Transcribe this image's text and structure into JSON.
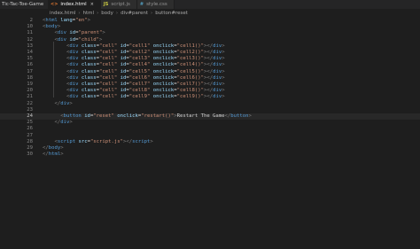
{
  "project": "Tic-Tac-Toe-Game",
  "tabs": [
    {
      "icon": "<>",
      "label": "index.html",
      "active": true,
      "close": "×"
    },
    {
      "icon": "JS",
      "label": "script.js",
      "active": false,
      "close": ""
    },
    {
      "icon": "#",
      "label": "style.css",
      "active": false,
      "close": ""
    }
  ],
  "breadcrumb": [
    "index.html",
    "html",
    "body",
    "div#parent",
    "button#reset"
  ],
  "lines": [
    {
      "num": "2",
      "tokens": [
        [
          "br",
          "<"
        ],
        [
          "tag",
          "html"
        ],
        [
          "txt",
          " "
        ],
        [
          "attr",
          "lang"
        ],
        [
          "txt",
          "="
        ],
        [
          "val",
          "\"en\""
        ],
        [
          "br",
          ">"
        ]
      ]
    },
    {
      "num": "10",
      "tokens": [
        [
          "br",
          "<"
        ],
        [
          "tag",
          "body"
        ],
        [
          "br",
          ">"
        ]
      ]
    },
    {
      "num": "11",
      "tokens": [
        [
          "txt",
          "    "
        ],
        [
          "br",
          "<"
        ],
        [
          "tag",
          "div"
        ],
        [
          "txt",
          " "
        ],
        [
          "attr",
          "id"
        ],
        [
          "txt",
          "="
        ],
        [
          "val",
          "\"parent\""
        ],
        [
          "br",
          ">"
        ]
      ]
    },
    {
      "num": "12",
      "tokens": [
        [
          "txt",
          "    "
        ],
        [
          "br",
          "<"
        ],
        [
          "tag",
          "div"
        ],
        [
          "txt",
          " "
        ],
        [
          "attr",
          "id"
        ],
        [
          "txt",
          "="
        ],
        [
          "val",
          "\"child\""
        ],
        [
          "br",
          ">"
        ]
      ]
    },
    {
      "num": "13",
      "tokens": [
        [
          "txt",
          "        "
        ],
        [
          "br",
          "<"
        ],
        [
          "tag",
          "div"
        ],
        [
          "txt",
          " "
        ],
        [
          "attr",
          "class"
        ],
        [
          "txt",
          "="
        ],
        [
          "val",
          "\"cell\""
        ],
        [
          "txt",
          " "
        ],
        [
          "attr",
          "id"
        ],
        [
          "txt",
          "="
        ],
        [
          "val",
          "\"cell1\""
        ],
        [
          "txt",
          " "
        ],
        [
          "attr",
          "onclick"
        ],
        [
          "txt",
          "="
        ],
        [
          "val",
          "\"cell1()\""
        ],
        [
          "br",
          "></"
        ],
        [
          "tag",
          "div"
        ],
        [
          "br",
          ">"
        ]
      ]
    },
    {
      "num": "14",
      "tokens": [
        [
          "txt",
          "        "
        ],
        [
          "br",
          "<"
        ],
        [
          "tag",
          "div"
        ],
        [
          "txt",
          " "
        ],
        [
          "attr",
          "class"
        ],
        [
          "txt",
          "="
        ],
        [
          "val",
          "\"cell\""
        ],
        [
          "txt",
          " "
        ],
        [
          "attr",
          "id"
        ],
        [
          "txt",
          "="
        ],
        [
          "val",
          "\"cell2\""
        ],
        [
          "txt",
          " "
        ],
        [
          "attr",
          "onclick"
        ],
        [
          "txt",
          "="
        ],
        [
          "val",
          "\"cell2()\""
        ],
        [
          "br",
          "></"
        ],
        [
          "tag",
          "div"
        ],
        [
          "br",
          ">"
        ]
      ]
    },
    {
      "num": "15",
      "tokens": [
        [
          "txt",
          "        "
        ],
        [
          "br",
          "<"
        ],
        [
          "tag",
          "div"
        ],
        [
          "txt",
          " "
        ],
        [
          "attr",
          "class"
        ],
        [
          "txt",
          "="
        ],
        [
          "val",
          "\"cell\""
        ],
        [
          "txt",
          " "
        ],
        [
          "attr",
          "id"
        ],
        [
          "txt",
          "="
        ],
        [
          "val",
          "\"cell3\""
        ],
        [
          "txt",
          " "
        ],
        [
          "attr",
          "onclick"
        ],
        [
          "txt",
          "="
        ],
        [
          "val",
          "\"cell3()\""
        ],
        [
          "br",
          "></"
        ],
        [
          "tag",
          "div"
        ],
        [
          "br",
          ">"
        ]
      ]
    },
    {
      "num": "16",
      "tokens": [
        [
          "txt",
          "        "
        ],
        [
          "br",
          "<"
        ],
        [
          "tag",
          "div"
        ],
        [
          "txt",
          " "
        ],
        [
          "attr",
          "class"
        ],
        [
          "txt",
          "="
        ],
        [
          "val",
          "\"cell\""
        ],
        [
          "txt",
          " "
        ],
        [
          "attr",
          "id"
        ],
        [
          "txt",
          "="
        ],
        [
          "val",
          "\"cell4\""
        ],
        [
          "txt",
          " "
        ],
        [
          "attr",
          "onclick"
        ],
        [
          "txt",
          "="
        ],
        [
          "val",
          "\"cell4()\""
        ],
        [
          "br",
          "></"
        ],
        [
          "tag",
          "div"
        ],
        [
          "br",
          ">"
        ]
      ]
    },
    {
      "num": "17",
      "tokens": [
        [
          "txt",
          "        "
        ],
        [
          "br",
          "<"
        ],
        [
          "tag",
          "div"
        ],
        [
          "txt",
          " "
        ],
        [
          "attr",
          "class"
        ],
        [
          "txt",
          "="
        ],
        [
          "val",
          "\"cell\""
        ],
        [
          "txt",
          " "
        ],
        [
          "attr",
          "id"
        ],
        [
          "txt",
          "="
        ],
        [
          "val",
          "\"cell5\""
        ],
        [
          "txt",
          " "
        ],
        [
          "attr",
          "onclick"
        ],
        [
          "txt",
          "="
        ],
        [
          "val",
          "\"cell5()\""
        ],
        [
          "br",
          "></"
        ],
        [
          "tag",
          "div"
        ],
        [
          "br",
          ">"
        ]
      ]
    },
    {
      "num": "18",
      "tokens": [
        [
          "txt",
          "        "
        ],
        [
          "br",
          "<"
        ],
        [
          "tag",
          "div"
        ],
        [
          "txt",
          " "
        ],
        [
          "attr",
          "class"
        ],
        [
          "txt",
          "="
        ],
        [
          "val",
          "\"cell\""
        ],
        [
          "txt",
          " "
        ],
        [
          "attr",
          "id"
        ],
        [
          "txt",
          "="
        ],
        [
          "val",
          "\"cell6\""
        ],
        [
          "txt",
          " "
        ],
        [
          "attr",
          "onclick"
        ],
        [
          "txt",
          "="
        ],
        [
          "val",
          "\"cell6()\""
        ],
        [
          "br",
          "></"
        ],
        [
          "tag",
          "div"
        ],
        [
          "br",
          ">"
        ]
      ]
    },
    {
      "num": "19",
      "tokens": [
        [
          "txt",
          "        "
        ],
        [
          "br",
          "<"
        ],
        [
          "tag",
          "div"
        ],
        [
          "txt",
          " "
        ],
        [
          "attr",
          "class"
        ],
        [
          "txt",
          "="
        ],
        [
          "val",
          "\"cell\""
        ],
        [
          "txt",
          " "
        ],
        [
          "attr",
          "id"
        ],
        [
          "txt",
          "="
        ],
        [
          "val",
          "\"cell7\""
        ],
        [
          "txt",
          " "
        ],
        [
          "attr",
          "onclick"
        ],
        [
          "txt",
          "="
        ],
        [
          "val",
          "\"cell7()\""
        ],
        [
          "br",
          "></"
        ],
        [
          "tag",
          "div"
        ],
        [
          "br",
          ">"
        ]
      ]
    },
    {
      "num": "20",
      "tokens": [
        [
          "txt",
          "        "
        ],
        [
          "br",
          "<"
        ],
        [
          "tag",
          "div"
        ],
        [
          "txt",
          " "
        ],
        [
          "attr",
          "class"
        ],
        [
          "txt",
          "="
        ],
        [
          "val",
          "\"cell\""
        ],
        [
          "txt",
          " "
        ],
        [
          "attr",
          "id"
        ],
        [
          "txt",
          "="
        ],
        [
          "val",
          "\"cell8\""
        ],
        [
          "txt",
          " "
        ],
        [
          "attr",
          "onclick"
        ],
        [
          "txt",
          "="
        ],
        [
          "val",
          "\"cell8()\""
        ],
        [
          "br",
          "></"
        ],
        [
          "tag",
          "div"
        ],
        [
          "br",
          ">"
        ]
      ]
    },
    {
      "num": "21",
      "tokens": [
        [
          "txt",
          "        "
        ],
        [
          "br",
          "<"
        ],
        [
          "tag",
          "div"
        ],
        [
          "txt",
          " "
        ],
        [
          "attr",
          "class"
        ],
        [
          "txt",
          "="
        ],
        [
          "val",
          "\"cell\""
        ],
        [
          "txt",
          " "
        ],
        [
          "attr",
          "id"
        ],
        [
          "txt",
          "="
        ],
        [
          "val",
          "\"cell9\""
        ],
        [
          "txt",
          " "
        ],
        [
          "attr",
          "onclick"
        ],
        [
          "txt",
          "="
        ],
        [
          "val",
          "\"cell9()\""
        ],
        [
          "br",
          "></"
        ],
        [
          "tag",
          "div"
        ],
        [
          "br",
          ">"
        ]
      ]
    },
    {
      "num": "22",
      "tokens": [
        [
          "txt",
          "    "
        ],
        [
          "br",
          "</"
        ],
        [
          "tag",
          "div"
        ],
        [
          "br",
          ">"
        ]
      ]
    },
    {
      "num": "23",
      "tokens": []
    },
    {
      "num": "24",
      "tokens": [
        [
          "txt",
          "      "
        ],
        [
          "br",
          "<"
        ],
        [
          "tag",
          "button"
        ],
        [
          "txt",
          " "
        ],
        [
          "attr",
          "id"
        ],
        [
          "txt",
          "="
        ],
        [
          "val",
          "\"reset\""
        ],
        [
          "txt",
          " "
        ],
        [
          "attr",
          "onclick"
        ],
        [
          "txt",
          "="
        ],
        [
          "val",
          "\"restart()\""
        ],
        [
          "br",
          ">"
        ],
        [
          "txt",
          "Restart The Game"
        ],
        [
          "br",
          "</"
        ],
        [
          "tag",
          "button"
        ],
        [
          "br",
          ">"
        ]
      ],
      "current": true
    },
    {
      "num": "25",
      "tokens": [
        [
          "txt",
          "    "
        ],
        [
          "br",
          "</"
        ],
        [
          "tag",
          "div"
        ],
        [
          "br",
          ">"
        ]
      ]
    },
    {
      "num": "26",
      "tokens": []
    },
    {
      "num": "27",
      "tokens": []
    },
    {
      "num": "28",
      "tokens": [
        [
          "txt",
          "    "
        ],
        [
          "br",
          "<"
        ],
        [
          "tag",
          "script"
        ],
        [
          "txt",
          " "
        ],
        [
          "attr",
          "src"
        ],
        [
          "txt",
          "="
        ],
        [
          "val",
          "\"script.js\""
        ],
        [
          "br",
          "></"
        ],
        [
          "tag",
          "script"
        ],
        [
          "br",
          ">"
        ]
      ]
    },
    {
      "num": "29",
      "tokens": [
        [
          "br",
          "</"
        ],
        [
          "tag",
          "body"
        ],
        [
          "br",
          ">"
        ]
      ]
    },
    {
      "num": "30",
      "tokens": [
        [
          "br",
          "</"
        ],
        [
          "tag",
          "html"
        ],
        [
          "br",
          ">"
        ]
      ]
    }
  ],
  "colors": {
    "background": "#1e1e1e",
    "tag": "#569cd6",
    "attribute": "#9cdcfe",
    "string": "#ce9178",
    "text": "#d4d4d4",
    "bracket": "#808080",
    "line_number": "#858585"
  }
}
